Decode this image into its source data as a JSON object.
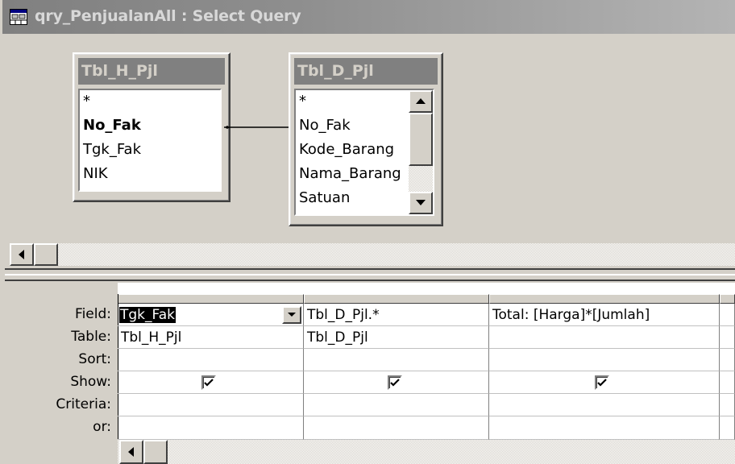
{
  "window": {
    "title": "qry_PenjualanAll : Select Query"
  },
  "tables": [
    {
      "name": "Tbl_H_Pjl",
      "fields": [
        {
          "label": "*",
          "primary_key": false
        },
        {
          "label": "No_Fak",
          "primary_key": true
        },
        {
          "label": "Tgk_Fak",
          "primary_key": false
        },
        {
          "label": "NIK",
          "primary_key": false
        }
      ]
    },
    {
      "name": "Tbl_D_Pjl",
      "fields": [
        {
          "label": "*",
          "primary_key": false
        },
        {
          "label": "No_Fak",
          "primary_key": false
        },
        {
          "label": "Kode_Barang",
          "primary_key": false
        },
        {
          "label": "Nama_Barang",
          "primary_key": false
        },
        {
          "label": "Satuan",
          "primary_key": false
        }
      ]
    }
  ],
  "relationship": {
    "from": "Tbl_H_Pjl.No_Fak",
    "to": "Tbl_D_Pjl.No_Fak"
  },
  "grid": {
    "row_labels": [
      "Field:",
      "Table:",
      "Sort:",
      "Show:",
      "Criteria:",
      "or:"
    ],
    "columns": [
      {
        "field": "Tgk_Fak",
        "table": "Tbl_H_Pjl",
        "sort": "",
        "show": true,
        "criteria": "",
        "or": "",
        "selected": true
      },
      {
        "field": "Tbl_D_Pjl.*",
        "table": "Tbl_D_Pjl",
        "sort": "",
        "show": true,
        "criteria": "",
        "or": "",
        "selected": false
      },
      {
        "field": "Total: [Harga]*[Jumlah]",
        "table": "",
        "sort": "",
        "show": true,
        "criteria": "",
        "or": "",
        "selected": false
      }
    ]
  },
  "icons": {
    "window_icon": "query-design-icon",
    "scroll_left": "arrow-left-icon",
    "scroll_up": "arrow-up-icon",
    "scroll_down": "arrow-down-icon",
    "dropdown": "chevron-down-icon",
    "checkbox": "checkmark-icon"
  },
  "colors": {
    "titlebar_inactive": "#808080",
    "face": "#d4d0c8",
    "selection": "#000000"
  }
}
